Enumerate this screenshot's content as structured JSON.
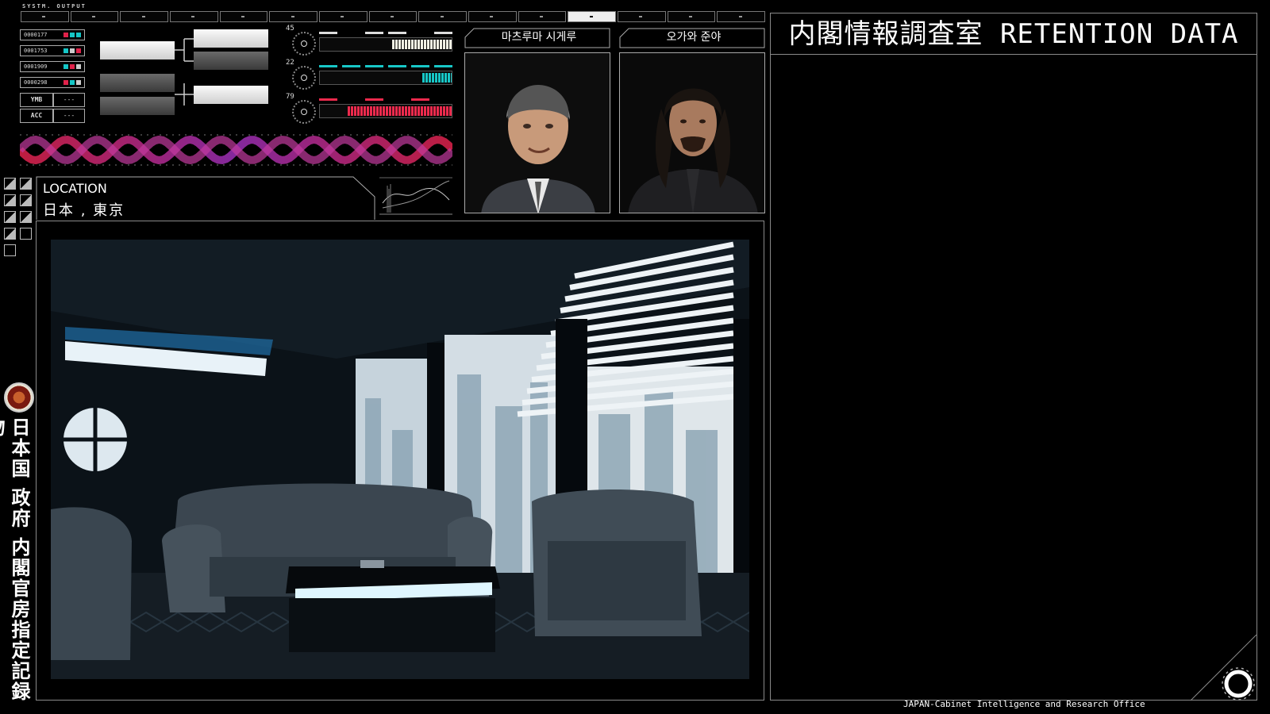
{
  "header": {
    "system_label": "SYSTM. OUTPUT",
    "segments": 15,
    "active_segment": 11
  },
  "codes": [
    {
      "id": "0000177",
      "dots": [
        "#e0224a",
        "#15c6c6",
        "#15c6c6"
      ]
    },
    {
      "id": "0001753",
      "dots": [
        "#15c6c6",
        "#cccccc",
        "#e0224a"
      ]
    },
    {
      "id": "0001909",
      "dots": [
        "#15c6c6",
        "#e0224a",
        "#cccccc"
      ]
    },
    {
      "id": "0000298",
      "dots": [
        "#e0224a",
        "#15c6c6",
        "#cccccc"
      ]
    }
  ],
  "fields": [
    {
      "key": "YMB",
      "value": "---"
    },
    {
      "key": "ACC",
      "value": "---"
    }
  ],
  "gauges": [
    {
      "value": "45",
      "color": "#f0efe2"
    },
    {
      "value": "22",
      "color": "#17c7c7"
    },
    {
      "value": "79",
      "color": "#ec2a4d"
    }
  ],
  "location": {
    "label": "LOCATION",
    "value": "日本 , 東京"
  },
  "persons": [
    {
      "name": "마츠루마 시게루"
    },
    {
      "name": "오가와 준야"
    }
  ],
  "side_title": "日本国 政府 内閣官房指定記録物",
  "panel": {
    "title": "内閣情報調査室 RETENTION DATA"
  },
  "footer": {
    "text": "JAPAN-Cabinet Intelligence and Research Office"
  },
  "colors": {
    "accent_red": "#ec2a4d",
    "accent_cyan": "#17c7c7",
    "frame": "#8a8a8a"
  }
}
